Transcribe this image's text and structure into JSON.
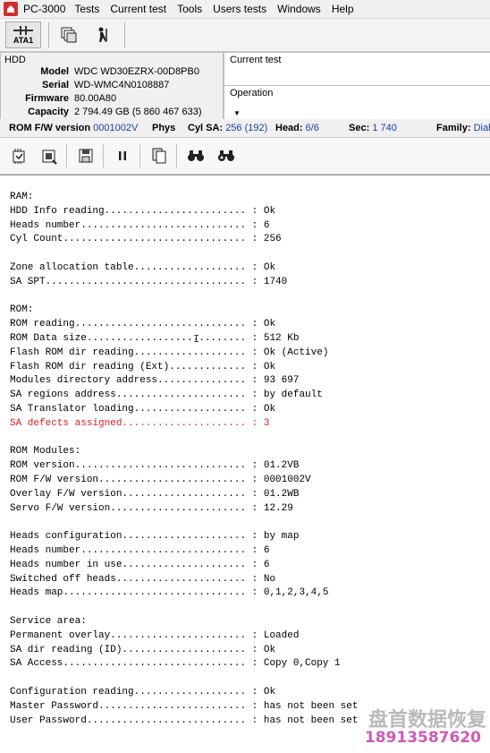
{
  "app": {
    "title": "PC-3000",
    "menu": [
      "Tests",
      "Current test",
      "Tools",
      "Users tests",
      "Windows",
      "Help"
    ]
  },
  "toolbar1": {
    "ata_label": "ATA1"
  },
  "hdd_panel": {
    "legend": "HDD",
    "fields": [
      {
        "label": "Model",
        "value": "WDC WD30EZRX-00D8PB0"
      },
      {
        "label": "Serial",
        "value": "WD-WMC4N0108887"
      },
      {
        "label": "Firmware",
        "value": "80.00A80"
      },
      {
        "label": "Capacity",
        "value": "2 794.49 GB (5 860 467 633)"
      }
    ]
  },
  "current_test_panel": {
    "label": "Current test"
  },
  "operation_panel": {
    "label": "Operation"
  },
  "statusbar": {
    "rom_fw_label": "ROM F/W version",
    "rom_fw_value": "0001002V",
    "phys_label": "Phys",
    "cyl_sa_label": "Cyl SA:",
    "cyl_sa_value": "256 (192)",
    "head_label": "Head:",
    "head_value": "6/6",
    "sec_label": "Sec:",
    "sec_value": "1 740",
    "family_label": "Family:",
    "family_value": "Diab"
  },
  "log": [
    {
      "text": "RAM:",
      "red": false
    },
    {
      "text": "HDD Info reading........................ : Ok",
      "red": false
    },
    {
      "text": "Heads number............................ : 6",
      "red": false
    },
    {
      "text": "Cyl Count............................... : 256",
      "red": false
    },
    {
      "text": "",
      "red": false
    },
    {
      "text": "Zone allocation table................... : Ok",
      "red": false
    },
    {
      "text": "SA SPT.................................. : 1740",
      "red": false
    },
    {
      "text": "",
      "red": false
    },
    {
      "text": "ROM:",
      "red": false
    },
    {
      "text": "ROM reading............................. : Ok",
      "red": false
    },
    {
      "text": "ROM Data size........................... : 512 Kb",
      "red": false
    },
    {
      "text": "Flash ROM dir reading................... : Ok (Active)",
      "red": false
    },
    {
      "text": "Flash ROM dir reading (Ext)............. : Ok",
      "red": false
    },
    {
      "text": "Modules directory address............... : 93 697",
      "red": false
    },
    {
      "text": "SA regions address...................... : by default",
      "red": false
    },
    {
      "text": "SA Translator loading................... : Ok",
      "red": false
    },
    {
      "text": "SA defects assigned..................... : 3",
      "red": true
    },
    {
      "text": "",
      "red": false
    },
    {
      "text": "ROM Modules:",
      "red": false
    },
    {
      "text": "ROM version............................. : 01.2VB",
      "red": false
    },
    {
      "text": "ROM F/W version......................... : 0001002V",
      "red": false
    },
    {
      "text": "Overlay F/W version..................... : 01.2WB",
      "red": false
    },
    {
      "text": "Servo F/W version....................... : 12.29",
      "red": false
    },
    {
      "text": "",
      "red": false
    },
    {
      "text": "Heads configuration..................... : by map",
      "red": false
    },
    {
      "text": "Heads number............................ : 6",
      "red": false
    },
    {
      "text": "Heads number in use..................... : 6",
      "red": false
    },
    {
      "text": "Switched off heads...................... : No",
      "red": false
    },
    {
      "text": "Heads map............................... : 0,1,2,3,4,5",
      "red": false
    },
    {
      "text": "",
      "red": false
    },
    {
      "text": "Service area:",
      "red": false
    },
    {
      "text": "Permanent overlay....................... : Loaded",
      "red": false
    },
    {
      "text": "SA dir reading (ID)..................... : Ok",
      "red": false
    },
    {
      "text": "SA Access............................... : Copy 0,Copy 1",
      "red": false
    },
    {
      "text": "",
      "red": false
    },
    {
      "text": "Configuration reading................... : Ok",
      "red": false
    },
    {
      "text": "Master Password......................... : has not been set",
      "red": false
    },
    {
      "text": "User Password........................... : has not been set",
      "red": false
    }
  ],
  "watermark": {
    "title": "盘首数据恢复",
    "phone": "18913587620"
  },
  "icons": {
    "app": "pc3000-icon",
    "ata": "ata-connector-icon",
    "toolbar1": [
      "windows-cascade-icon",
      "person-run-icon"
    ],
    "toolbar2": [
      "chip-read-icon",
      "chip-write-icon",
      "save-icon",
      "pause-icon",
      "copy-icon",
      "binoculars-icon",
      "binoculars-find-icon"
    ]
  },
  "colors": {
    "red_text": "#e02020",
    "blue_value": "#1b3fae",
    "app_icon": "#d32f2f"
  }
}
